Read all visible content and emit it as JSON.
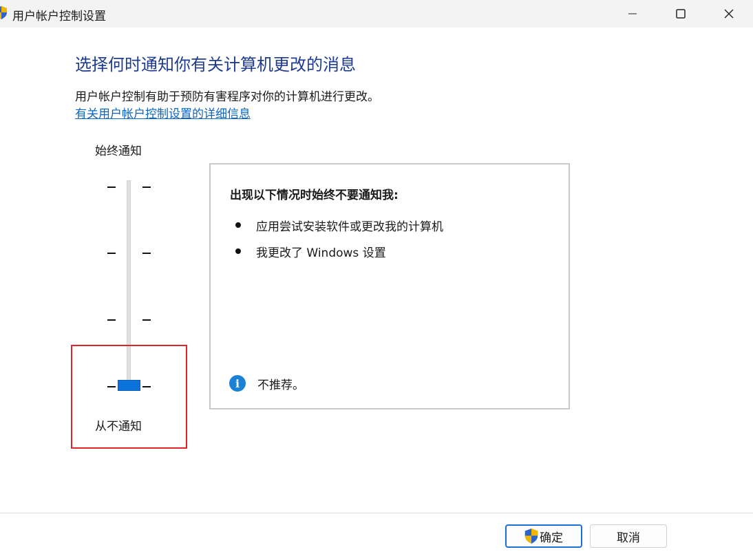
{
  "window": {
    "title": "用户帐户控制设置",
    "icon": "uac-shield-icon",
    "controls": [
      "minimize-icon",
      "maximize-icon",
      "close-icon"
    ]
  },
  "main": {
    "heading": "选择何时通知你有关计算机更改的消息",
    "description": "用户帐户控制有助于预防有害程序对你的计算机进行更改。",
    "help_link": "有关用户帐户控制设置的详细信息"
  },
  "slider": {
    "top_label": "始终通知",
    "bottom_label": "从不通知",
    "level_count": 4,
    "selected_level": 1
  },
  "panel": {
    "heading": "出现以下情况时始终不要通知我:",
    "bullets": [
      "应用尝试安装软件或更改我的计算机",
      "我更改了 Windows 设置"
    ],
    "info_icon": "info-icon",
    "info_text": "不推荐。"
  },
  "footer": {
    "ok_label": "确定",
    "cancel_label": "取消"
  },
  "colors": {
    "heading": "#1e3b8f",
    "link": "#0a64c2",
    "slider_thumb": "#0a72d8",
    "highlight": "#e0232b"
  }
}
